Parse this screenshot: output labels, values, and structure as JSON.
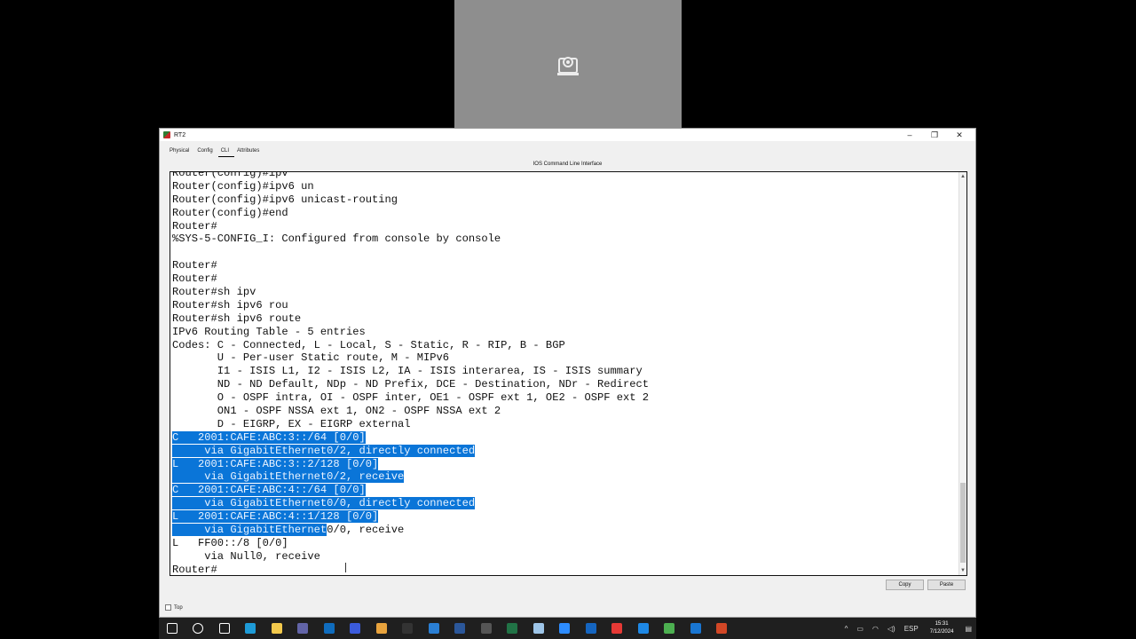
{
  "window": {
    "title": "RT2",
    "tabs": [
      {
        "label": "Physical",
        "active": false
      },
      {
        "label": "Config",
        "active": false
      },
      {
        "label": "CLI",
        "active": true
      },
      {
        "label": "Attributes",
        "active": false
      }
    ],
    "cli_caption": "IOS Command Line Interface",
    "copy_label": "Copy",
    "paste_label": "Paste",
    "top_label": "Top"
  },
  "terminal": {
    "lines": [
      {
        "text": "Router(config)#ipv",
        "hl": false
      },
      {
        "text": "Router(config)#ipv6 un",
        "hl": false
      },
      {
        "text": "Router(config)#ipv6 unicast-routing",
        "hl": false
      },
      {
        "text": "Router(config)#end",
        "hl": false
      },
      {
        "text": "Router#",
        "hl": false
      },
      {
        "text": "%SYS-5-CONFIG_I: Configured from console by console",
        "hl": false
      },
      {
        "text": "",
        "hl": false
      },
      {
        "text": "Router#",
        "hl": false
      },
      {
        "text": "Router#",
        "hl": false
      },
      {
        "text": "Router#sh ipv",
        "hl": false
      },
      {
        "text": "Router#sh ipv6 rou",
        "hl": false
      },
      {
        "text": "Router#sh ipv6 route",
        "hl": false
      },
      {
        "text": "IPv6 Routing Table - 5 entries",
        "hl": false
      },
      {
        "text": "Codes: C - Connected, L - Local, S - Static, R - RIP, B - BGP",
        "hl": false
      },
      {
        "text": "       U - Per-user Static route, M - MIPv6",
        "hl": false
      },
      {
        "text": "       I1 - ISIS L1, I2 - ISIS L2, IA - ISIS interarea, IS - ISIS summary",
        "hl": false
      },
      {
        "text": "       ND - ND Default, NDp - ND Prefix, DCE - Destination, NDr - Redirect",
        "hl": false
      },
      {
        "text": "       O - OSPF intra, OI - OSPF inter, OE1 - OSPF ext 1, OE2 - OSPF ext 2",
        "hl": false
      },
      {
        "text": "       ON1 - OSPF NSSA ext 1, ON2 - OSPF NSSA ext 2",
        "hl": false
      },
      {
        "text": "       D - EIGRP, EX - EIGRP external",
        "hl": false
      },
      {
        "text": "C   2001:CAFE:ABC:3::/64 [0/0]",
        "hl": true
      },
      {
        "text": "     via GigabitEthernet0/2, directly connected",
        "hl": true
      },
      {
        "text": "L   2001:CAFE:ABC:3::2/128 [0/0]",
        "hl": true
      },
      {
        "text": "     via GigabitEthernet0/2, receive",
        "hl": true
      },
      {
        "text": "C   2001:CAFE:ABC:4::/64 [0/0]",
        "hl": true
      },
      {
        "text": "     via GigabitEthernet0/0, directly connected",
        "hl": true
      },
      {
        "text": "L   2001:CAFE:ABC:4::1/128 [0/0]",
        "hl": true
      },
      {
        "text": "     via GigabitEthernet0/0, receive",
        "hl": "partial",
        "hl_chars": 24
      },
      {
        "text": "L   FF00::/8 [0/0]",
        "hl": false
      },
      {
        "text": "     via Null0, receive",
        "hl": false
      },
      {
        "text": "Router#",
        "hl": false
      }
    ]
  },
  "taskbar": {
    "icons": [
      {
        "name": "windows-start-icon",
        "color": "#ffffff"
      },
      {
        "name": "search-icon",
        "color": "#ffffff"
      },
      {
        "name": "task-view-icon",
        "color": "#ffffff"
      },
      {
        "name": "edge-icon",
        "color": "#1e9bd7"
      },
      {
        "name": "file-explorer-icon",
        "color": "#f2c94c"
      },
      {
        "name": "teams-icon",
        "color": "#6264a7"
      },
      {
        "name": "outlook-icon",
        "color": "#0f6cbd"
      },
      {
        "name": "app-icon",
        "color": "#3b5bdb"
      },
      {
        "name": "chrome-icon",
        "color": "#e8a33d"
      },
      {
        "name": "terminal-icon",
        "color": "#333333"
      },
      {
        "name": "mail-icon",
        "color": "#2a7fd4"
      },
      {
        "name": "word-icon",
        "color": "#2b579a"
      },
      {
        "name": "calculator-icon",
        "color": "#555555"
      },
      {
        "name": "excel-icon",
        "color": "#217346"
      },
      {
        "name": "notes-icon",
        "color": "#9ec5e8"
      },
      {
        "name": "zoom-icon",
        "color": "#2d8cff"
      },
      {
        "name": "shield-icon",
        "color": "#1565c0"
      },
      {
        "name": "app-s-icon",
        "color": "#e53935"
      },
      {
        "name": "app-s2-icon",
        "color": "#1e88e5"
      },
      {
        "name": "packet-tracer-icon",
        "color": "#4caf50"
      },
      {
        "name": "app-w-icon",
        "color": "#1976d2"
      },
      {
        "name": "powerpoint-icon",
        "color": "#d24726"
      }
    ],
    "language": "ESP",
    "time": "15:31",
    "date": "7/12/2024"
  }
}
